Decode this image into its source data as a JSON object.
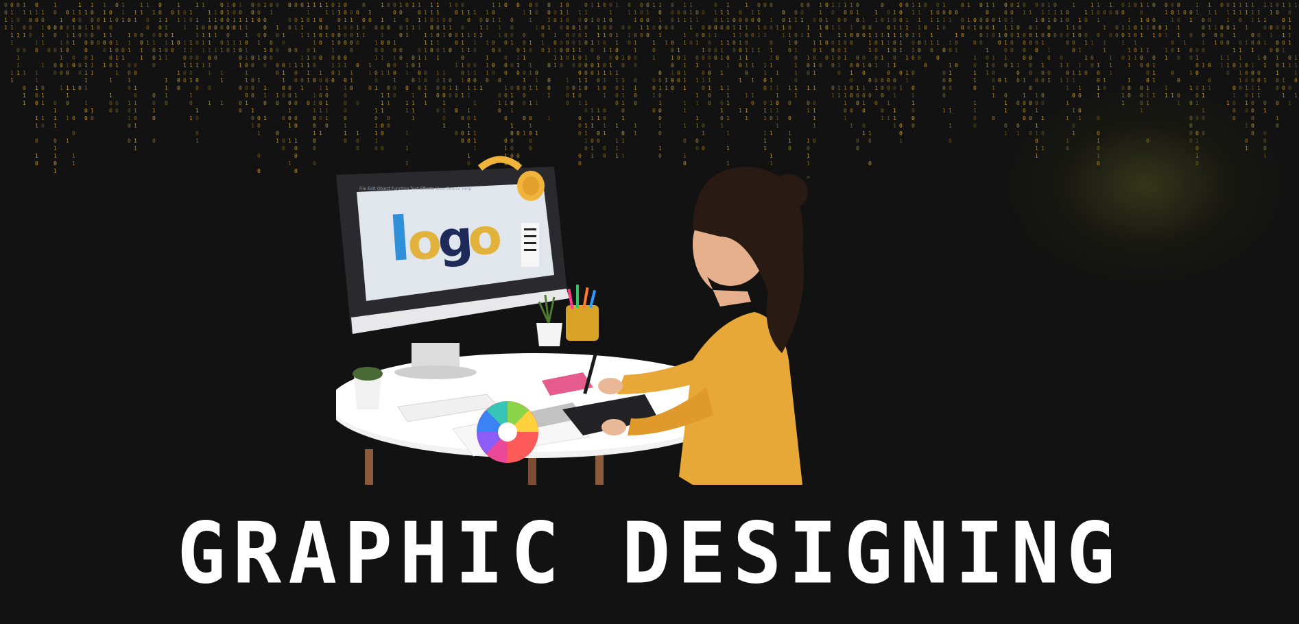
{
  "headline": "GRAPHIC DESIGNING",
  "screen_logo": {
    "l": "l",
    "o1": "o",
    "g": "g",
    "o2": "o"
  },
  "screen_menu": [
    "File",
    "Edit",
    "Object",
    "Function",
    "Text",
    "Effects",
    "View",
    "Search",
    "Help"
  ],
  "colors": {
    "background": "#121212",
    "binary_digits": "#d9a72c",
    "headline": "#ffffff",
    "shirt": "#e8a838",
    "logo_blue": "#2f8fd8",
    "logo_yellow": "#e2b33c",
    "logo_navy": "#1e2a5a"
  },
  "icons": {
    "binary_rain": "binary-code-rain",
    "headphones": "headphones-icon",
    "color_wheel": "color-wheel-icon"
  }
}
